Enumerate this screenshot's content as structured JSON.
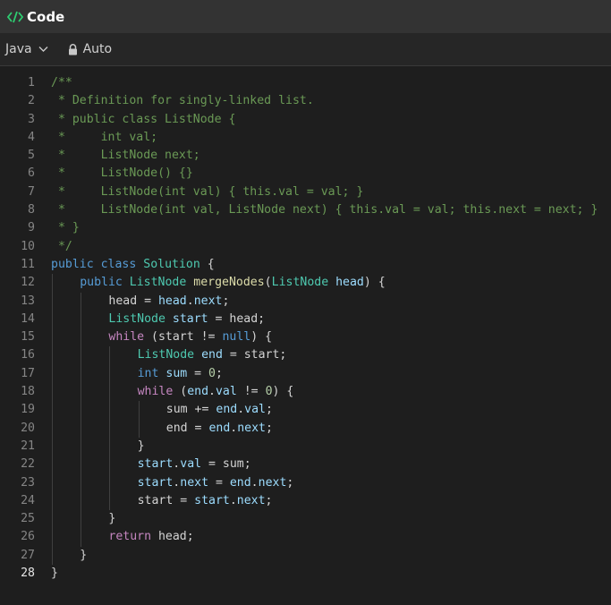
{
  "header": {
    "title": "Code",
    "icon": "code-brackets-icon",
    "accent": "#2ecc71"
  },
  "toolbar": {
    "language": "Java",
    "mode": "Auto"
  },
  "editor": {
    "active_line": 28,
    "lines": [
      {
        "n": "1",
        "indent": 0,
        "tokens": [
          [
            "comment",
            "/**"
          ]
        ]
      },
      {
        "n": "2",
        "indent": 0,
        "tokens": [
          [
            "comment",
            " * Definition for singly-linked list."
          ]
        ]
      },
      {
        "n": "3",
        "indent": 0,
        "tokens": [
          [
            "comment",
            " * public class ListNode {"
          ]
        ]
      },
      {
        "n": "4",
        "indent": 0,
        "tokens": [
          [
            "comment",
            " *     int val;"
          ]
        ]
      },
      {
        "n": "5",
        "indent": 0,
        "tokens": [
          [
            "comment",
            " *     ListNode next;"
          ]
        ]
      },
      {
        "n": "6",
        "indent": 0,
        "tokens": [
          [
            "comment",
            " *     ListNode() {}"
          ]
        ]
      },
      {
        "n": "7",
        "indent": 0,
        "tokens": [
          [
            "comment",
            " *     ListNode(int val) { this.val = val; }"
          ]
        ]
      },
      {
        "n": "8",
        "indent": 0,
        "tokens": [
          [
            "comment",
            " *     ListNode(int val, ListNode next) { this.val = val; this.next = next; }"
          ]
        ]
      },
      {
        "n": "9",
        "indent": 0,
        "tokens": [
          [
            "comment",
            " * }"
          ]
        ]
      },
      {
        "n": "10",
        "indent": 0,
        "tokens": [
          [
            "comment",
            " */"
          ]
        ]
      },
      {
        "n": "11",
        "indent": 0,
        "tokens": [
          [
            "keyword",
            "public"
          ],
          [
            "plain",
            " "
          ],
          [
            "keyword",
            "class"
          ],
          [
            "plain",
            " "
          ],
          [
            "type",
            "Solution"
          ],
          [
            "plain",
            " {"
          ]
        ]
      },
      {
        "n": "12",
        "indent": 1,
        "tokens": [
          [
            "keyword",
            "public"
          ],
          [
            "plain",
            " "
          ],
          [
            "type",
            "ListNode"
          ],
          [
            "plain",
            " "
          ],
          [
            "func",
            "mergeNodes"
          ],
          [
            "plain",
            "("
          ],
          [
            "type",
            "ListNode"
          ],
          [
            "plain",
            " "
          ],
          [
            "var",
            "head"
          ],
          [
            "plain",
            ") {"
          ]
        ]
      },
      {
        "n": "13",
        "indent": 2,
        "tokens": [
          [
            "plain",
            "head = "
          ],
          [
            "var",
            "head"
          ],
          [
            "plain",
            "."
          ],
          [
            "var",
            "next"
          ],
          [
            "plain",
            ";"
          ]
        ]
      },
      {
        "n": "14",
        "indent": 2,
        "tokens": [
          [
            "type",
            "ListNode"
          ],
          [
            "plain",
            " "
          ],
          [
            "var",
            "start"
          ],
          [
            "plain",
            " = head;"
          ]
        ]
      },
      {
        "n": "15",
        "indent": 2,
        "tokens": [
          [
            "control",
            "while"
          ],
          [
            "plain",
            " (start != "
          ],
          [
            "keyword",
            "null"
          ],
          [
            "plain",
            ") {"
          ]
        ]
      },
      {
        "n": "16",
        "indent": 3,
        "tokens": [
          [
            "type",
            "ListNode"
          ],
          [
            "plain",
            " "
          ],
          [
            "var",
            "end"
          ],
          [
            "plain",
            " = start;"
          ]
        ]
      },
      {
        "n": "17",
        "indent": 3,
        "tokens": [
          [
            "keyword",
            "int"
          ],
          [
            "plain",
            " "
          ],
          [
            "var",
            "sum"
          ],
          [
            "plain",
            " = "
          ],
          [
            "num",
            "0"
          ],
          [
            "plain",
            ";"
          ]
        ]
      },
      {
        "n": "18",
        "indent": 3,
        "tokens": [
          [
            "control",
            "while"
          ],
          [
            "plain",
            " ("
          ],
          [
            "var",
            "end"
          ],
          [
            "plain",
            "."
          ],
          [
            "var",
            "val"
          ],
          [
            "plain",
            " != "
          ],
          [
            "num",
            "0"
          ],
          [
            "plain",
            ") {"
          ]
        ]
      },
      {
        "n": "19",
        "indent": 4,
        "tokens": [
          [
            "plain",
            "sum += "
          ],
          [
            "var",
            "end"
          ],
          [
            "plain",
            "."
          ],
          [
            "var",
            "val"
          ],
          [
            "plain",
            ";"
          ]
        ]
      },
      {
        "n": "20",
        "indent": 4,
        "tokens": [
          [
            "plain",
            "end = "
          ],
          [
            "var",
            "end"
          ],
          [
            "plain",
            "."
          ],
          [
            "var",
            "next"
          ],
          [
            "plain",
            ";"
          ]
        ]
      },
      {
        "n": "21",
        "indent": 3,
        "tokens": [
          [
            "plain",
            "}"
          ]
        ]
      },
      {
        "n": "22",
        "indent": 3,
        "tokens": [
          [
            "var",
            "start"
          ],
          [
            "plain",
            "."
          ],
          [
            "var",
            "val"
          ],
          [
            "plain",
            " = sum;"
          ]
        ]
      },
      {
        "n": "23",
        "indent": 3,
        "tokens": [
          [
            "var",
            "start"
          ],
          [
            "plain",
            "."
          ],
          [
            "var",
            "next"
          ],
          [
            "plain",
            " = "
          ],
          [
            "var",
            "end"
          ],
          [
            "plain",
            "."
          ],
          [
            "var",
            "next"
          ],
          [
            "plain",
            ";"
          ]
        ]
      },
      {
        "n": "24",
        "indent": 3,
        "tokens": [
          [
            "plain",
            "start = "
          ],
          [
            "var",
            "start"
          ],
          [
            "plain",
            "."
          ],
          [
            "var",
            "next"
          ],
          [
            "plain",
            ";"
          ]
        ]
      },
      {
        "n": "25",
        "indent": 2,
        "tokens": [
          [
            "plain",
            "}"
          ]
        ]
      },
      {
        "n": "26",
        "indent": 2,
        "tokens": [
          [
            "control",
            "return"
          ],
          [
            "plain",
            " head;"
          ]
        ]
      },
      {
        "n": "27",
        "indent": 1,
        "tokens": [
          [
            "plain",
            "}"
          ]
        ]
      },
      {
        "n": "28",
        "indent": 0,
        "tokens": [
          [
            "plain",
            "}"
          ]
        ]
      }
    ]
  }
}
